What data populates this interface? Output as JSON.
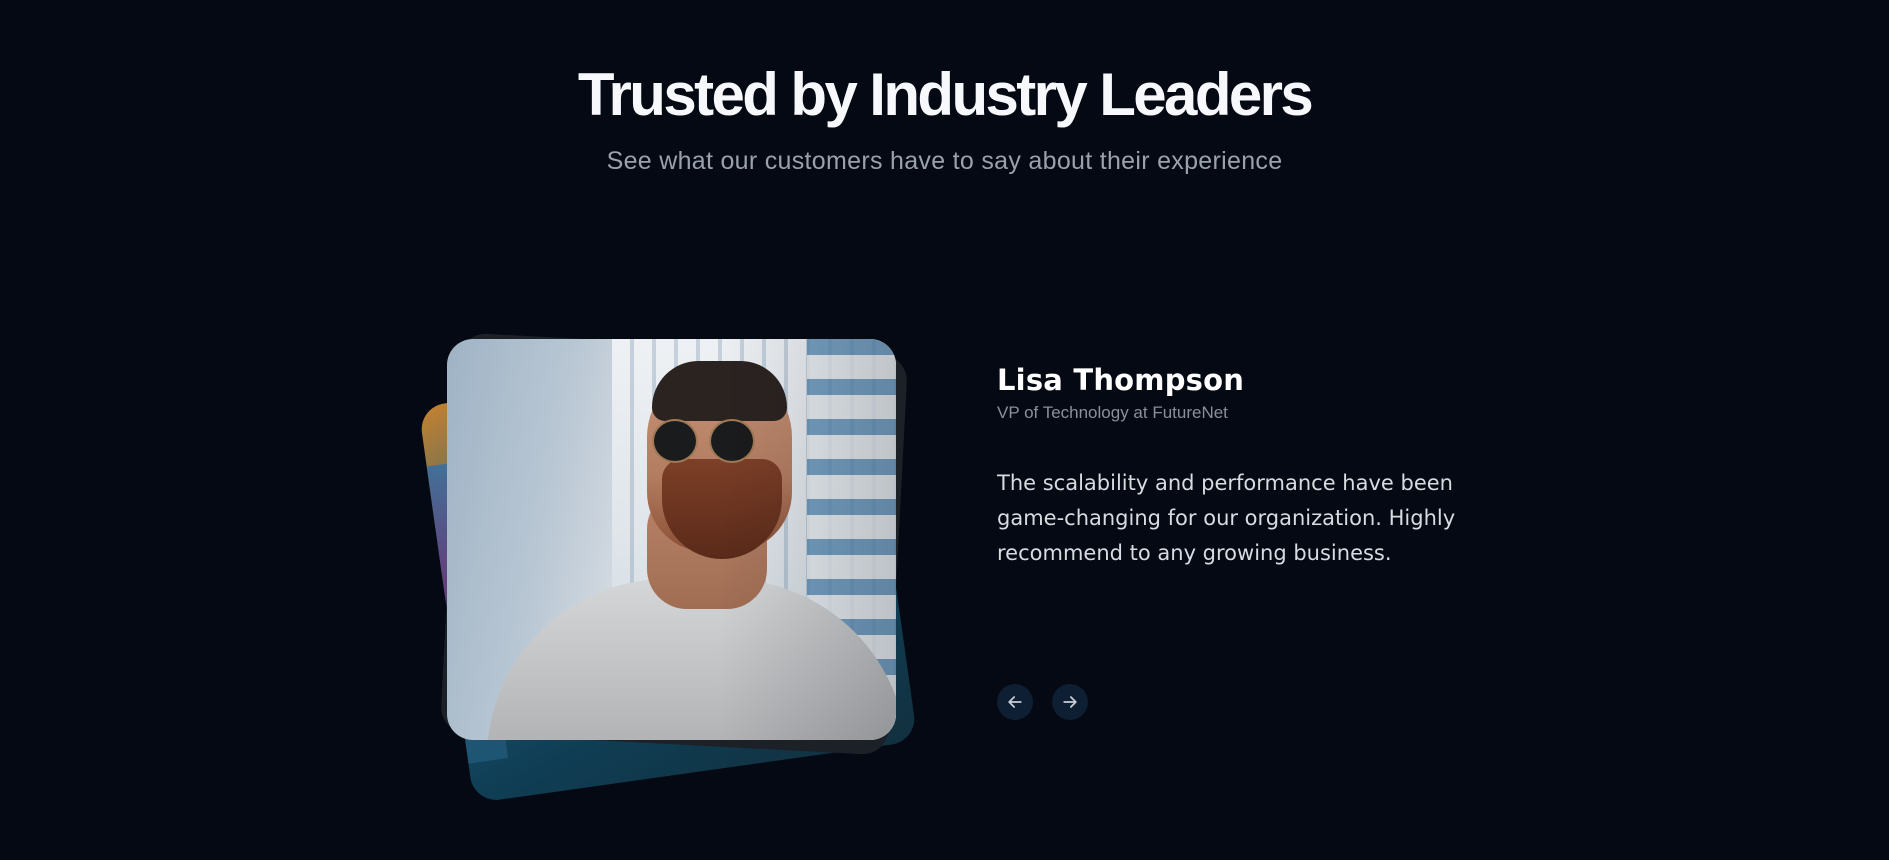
{
  "header": {
    "title": "Trusted by Industry Leaders",
    "subtitle": "See what our customers have to say about their experience"
  },
  "testimonial": {
    "name": "Lisa Thompson",
    "role": "VP of Technology at FutureNet",
    "quote": "The scalability and performance have been game-changing for our organization. Highly recommend to any growing business."
  },
  "navigation": {
    "prev_icon": "arrow-left-icon",
    "next_icon": "arrow-right-icon"
  },
  "colors": {
    "background": "#050913",
    "title": "#f7f8fb",
    "subtitle": "#9aa1ad",
    "nav_button": "#0f1f33"
  }
}
